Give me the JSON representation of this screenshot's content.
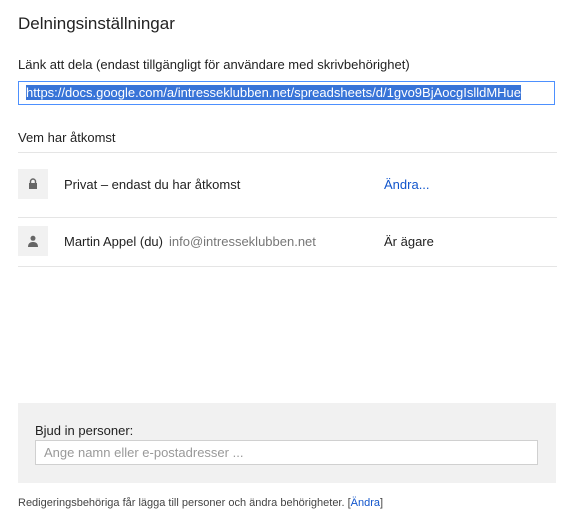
{
  "dialog": {
    "title": "Delningsinställningar"
  },
  "share_link": {
    "label": "Länk att dela (endast tillgängligt för användare med skrivbehörighet)",
    "url": "https://docs.google.com/a/intresseklubben.net/spreadsheets/d/1gvo9BjAocgIslldMHue"
  },
  "access": {
    "heading": "Vem har åtkomst",
    "rows": [
      {
        "icon": "lock-icon",
        "label": "Privat – endast du har åtkomst",
        "action": "Ändra..."
      },
      {
        "icon": "person-icon",
        "name": "Martin Appel (du)",
        "email": "info@intresseklubben.net",
        "role": "Är ägare"
      }
    ]
  },
  "invite": {
    "label": "Bjud in personer:",
    "placeholder": "Ange namn eller e-postadresser ...",
    "value": ""
  },
  "footer": {
    "text": "Redigeringsbehöriga får lägga till personer och ändra behörigheter. [",
    "link": "Ändra",
    "close": "]"
  },
  "colors": {
    "link": "#1155cc",
    "selection": "#3874d8",
    "focus_border": "#4d90fe"
  }
}
